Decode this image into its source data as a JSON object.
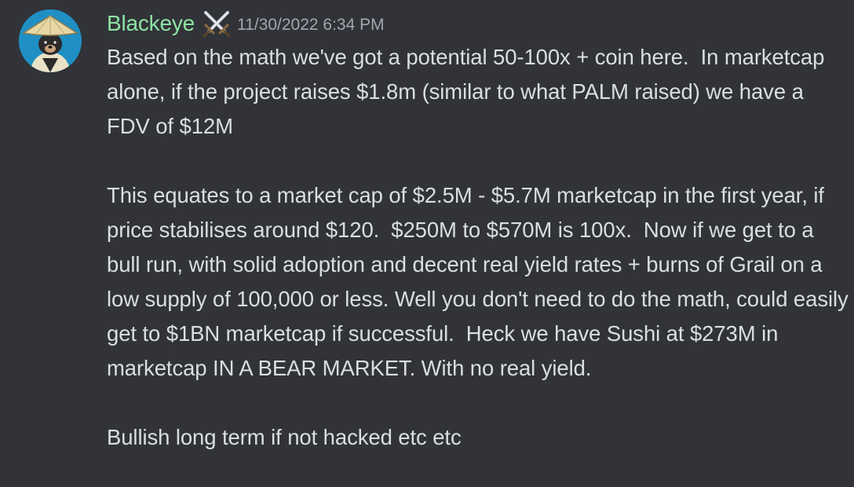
{
  "message": {
    "author": "Blackeye",
    "role_icon": "crossed-swords-icon",
    "timestamp": "11/30/2022 6:34 PM",
    "username_color": "#8ee3a4",
    "paragraphs": [
      "Based on the math we've got a potential 50-100x + coin here.  In marketcap alone, if the project raises $1.8m (similar to what PALM raised) we have a FDV of $12M",
      "This equates to a market cap of $2.5M - $5.7M marketcap in the first year, if price stabilises around $120.  $250M to $570M is 100x.  Now if we get to a bull run, with solid adoption and decent real yield rates + burns of Grail on a low supply of 100,000 or less. Well you don't need to do the math, could easily get to $1BN marketcap if successful.  Heck we have Sushi at $273M in marketcap IN A BEAR MARKET. With no real yield.",
      "Bullish long term if not hacked etc etc"
    ]
  }
}
